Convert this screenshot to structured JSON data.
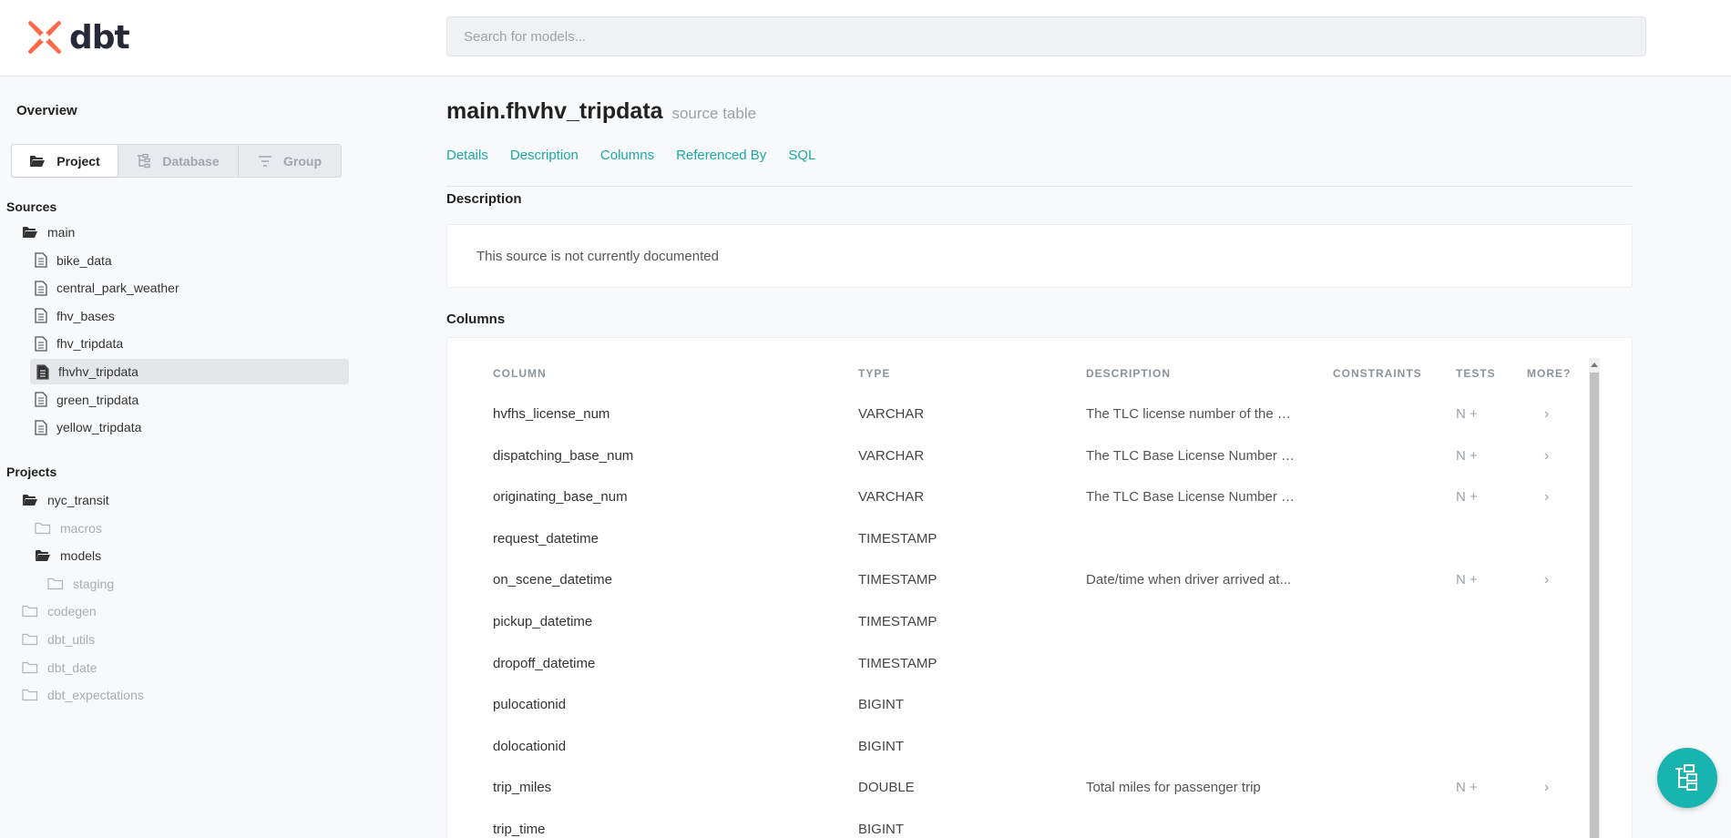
{
  "header": {
    "logo_text": "dbt",
    "search_placeholder": "Search for models..."
  },
  "sidebar": {
    "overview_label": "Overview",
    "view_tabs": [
      {
        "label": "Project",
        "icon": "folder-open-icon",
        "active": true
      },
      {
        "label": "Database",
        "icon": "tree-icon",
        "active": false
      },
      {
        "label": "Group",
        "icon": "filter-icon",
        "active": false
      }
    ],
    "sources_title": "Sources",
    "sources": [
      {
        "label": "main",
        "icon": "folder-open-icon",
        "level": 1
      },
      {
        "label": "bike_data",
        "icon": "file-icon",
        "level": 2
      },
      {
        "label": "central_park_weather",
        "icon": "file-icon",
        "level": 2
      },
      {
        "label": "fhv_bases",
        "icon": "file-icon",
        "level": 2
      },
      {
        "label": "fhv_tripdata",
        "icon": "file-icon",
        "level": 2
      },
      {
        "label": "fhvhv_tripdata",
        "icon": "file-icon",
        "level": 2,
        "selected": true
      },
      {
        "label": "green_tripdata",
        "icon": "file-icon",
        "level": 2
      },
      {
        "label": "yellow_tripdata",
        "icon": "file-icon",
        "level": 2
      }
    ],
    "projects_title": "Projects",
    "projects": [
      {
        "label": "nyc_transit",
        "icon": "folder-open-icon",
        "level": 1
      },
      {
        "label": "macros",
        "icon": "folder-icon",
        "level": 2,
        "muted": true
      },
      {
        "label": "models",
        "icon": "folder-open-icon",
        "level": 2
      },
      {
        "label": "staging",
        "icon": "folder-icon",
        "level": 3,
        "muted": true
      },
      {
        "label": "codegen",
        "icon": "folder-icon",
        "level": 1,
        "muted": true
      },
      {
        "label": "dbt_utils",
        "icon": "folder-icon",
        "level": 1,
        "muted": true
      },
      {
        "label": "dbt_date",
        "icon": "folder-icon",
        "level": 1,
        "muted": true
      },
      {
        "label": "dbt_expectations",
        "icon": "folder-icon",
        "level": 1,
        "muted": true
      }
    ]
  },
  "main": {
    "title": "main.fhvhv_tripdata",
    "subtitle": "source table",
    "tabs": [
      "Details",
      "Description",
      "Columns",
      "Referenced By",
      "SQL"
    ],
    "description_heading": "Description",
    "description_text": "This source is not currently documented",
    "columns_heading": "Columns",
    "column_headers": {
      "column": "COLUMN",
      "type": "TYPE",
      "description": "DESCRIPTION",
      "constraints": "CONSTRAINTS",
      "tests": "TESTS",
      "more": "MORE?"
    },
    "rows": [
      {
        "name": "hvfhs_license_num",
        "type": "VARCHAR",
        "description": "The TLC license number of the H...",
        "tests": "N +",
        "more": "›"
      },
      {
        "name": "dispatching_base_num",
        "type": "VARCHAR",
        "description": "The TLC Base License Number o...",
        "tests": "N +",
        "more": "›"
      },
      {
        "name": "originating_base_num",
        "type": "VARCHAR",
        "description": "The TLC Base License Number o...",
        "tests": "N +",
        "more": "›"
      },
      {
        "name": "request_datetime",
        "type": "TIMESTAMP",
        "description": "",
        "tests": "",
        "more": ""
      },
      {
        "name": "on_scene_datetime",
        "type": "TIMESTAMP",
        "description": "Date/time when driver arrived at...",
        "tests": "N +",
        "more": "›"
      },
      {
        "name": "pickup_datetime",
        "type": "TIMESTAMP",
        "description": "",
        "tests": "",
        "more": ""
      },
      {
        "name": "dropoff_datetime",
        "type": "TIMESTAMP",
        "description": "",
        "tests": "",
        "more": ""
      },
      {
        "name": "pulocationid",
        "type": "BIGINT",
        "description": "",
        "tests": "",
        "more": ""
      },
      {
        "name": "dolocationid",
        "type": "BIGINT",
        "description": "",
        "tests": "",
        "more": ""
      },
      {
        "name": "trip_miles",
        "type": "DOUBLE",
        "description": "Total miles for passenger trip",
        "tests": "N +",
        "more": "›"
      },
      {
        "name": "trip_time",
        "type": "BIGINT",
        "description": "",
        "tests": "",
        "more": ""
      }
    ]
  },
  "fab": {
    "icon": "lineage-graph-icon"
  },
  "colors": {
    "accent": "#1aa9a3",
    "logo": "#ff694a",
    "fab": "#18b4b0"
  }
}
